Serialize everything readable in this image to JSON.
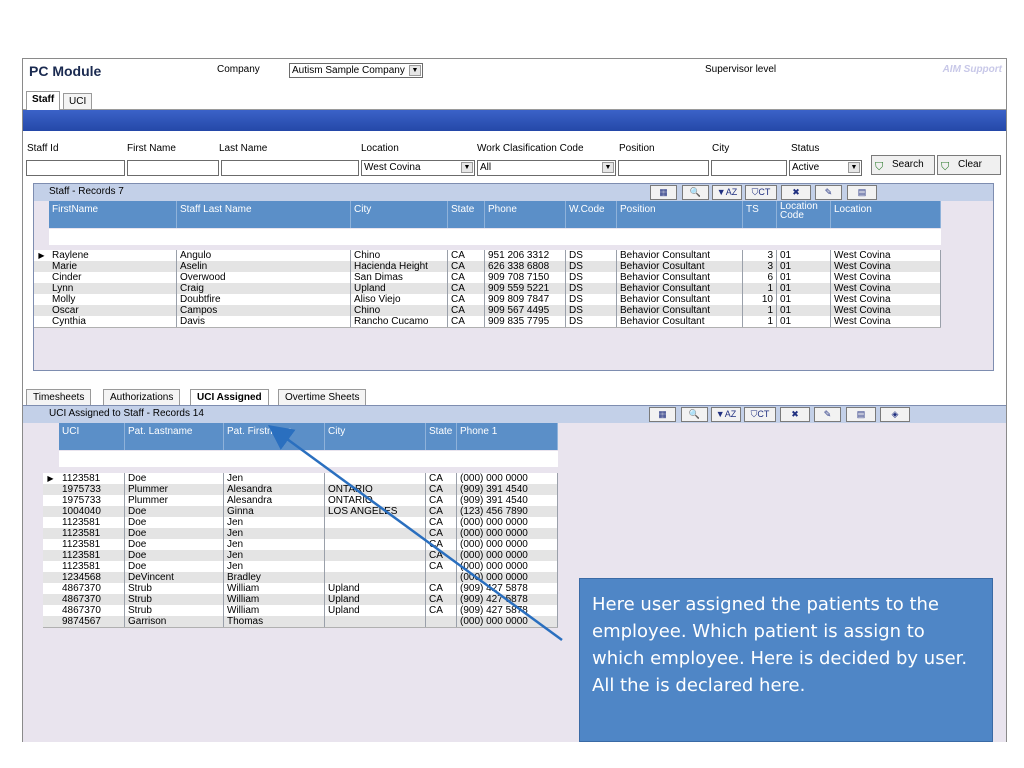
{
  "header": {
    "module_title": "PC Module",
    "company_label": "Company",
    "company_value": "Autism Sample Company",
    "supervisor_label": "Supervisor level",
    "support_label": "AIM Support"
  },
  "top_tabs": [
    "Staff",
    "UCI"
  ],
  "filters": {
    "labels": [
      "Staff Id",
      "First Name",
      "Last Name",
      "Location",
      "Work Clasification Code",
      "Position",
      "City",
      "Status"
    ],
    "location_value": "West Covina",
    "work_code_value": "All",
    "status_value": "Active",
    "search_label": "Search",
    "clear_label": "Clear"
  },
  "staff_grid": {
    "title": "Staff - Records 7",
    "toolbar": [
      "excel-icon",
      "preview-icon",
      "AZ",
      "CT",
      "clear-filter-icon",
      "edit-icon",
      "columns-icon"
    ],
    "columns": [
      "FirstName",
      "Staff Last Name",
      "City",
      "State",
      "Phone",
      "W.Code",
      "Position",
      "TS",
      "Location Code",
      "Location"
    ],
    "rows": [
      [
        "Raylene",
        "Angulo",
        "Chino",
        "CA",
        "951 206 3312",
        "DS",
        "Behavior Consultant",
        "3",
        "01",
        "West Covina"
      ],
      [
        "Marie",
        "Aselin",
        "Hacienda Height",
        "CA",
        "626 338 6808",
        "DS",
        "Behavior Cosultant",
        "3",
        "01",
        "West Covina"
      ],
      [
        "Cinder",
        "Overwood",
        "San Dimas",
        "CA",
        "909 708 7150",
        "DS",
        "Behavior Consultant",
        "6",
        "01",
        "West Covina"
      ],
      [
        "Lynn",
        "Craig",
        "Upland",
        "CA",
        "909 559 5221",
        "DS",
        "Behavior Consultant",
        "1",
        "01",
        "West Covina"
      ],
      [
        "Molly",
        "Doubtfire",
        "Aliso Viejo",
        "CA",
        "909 809 7847",
        "DS",
        "Behavior Consultant",
        "10",
        "01",
        "West Covina"
      ],
      [
        "Oscar",
        "Campos",
        "Chino",
        "CA",
        "909 567 4495",
        "DS",
        "Behavior Consultant",
        "1",
        "01",
        "West Covina"
      ],
      [
        "Cynthia",
        "Davis",
        "Rancho Cucamo",
        "CA",
        "909 835 7795",
        "DS",
        "Behavior Cosultant",
        "1",
        "01",
        "West Covina"
      ]
    ]
  },
  "lower_tabs": [
    "Timesheets",
    "Authorizations",
    "UCI Assigned",
    "Overtime Sheets"
  ],
  "uci_grid": {
    "title": "UCI Assigned to Staff  - Records 14",
    "columns": [
      "UCI",
      "Pat. Lastname",
      "Pat. Firstname",
      "City",
      "State",
      "Phone 1"
    ],
    "rows": [
      [
        "1123581",
        "Doe",
        "Jen",
        "",
        "CA",
        "(000) 000 0000"
      ],
      [
        "1975733",
        "Plummer",
        "Alesandra",
        "ONTARIO",
        "CA",
        "(909) 391 4540"
      ],
      [
        "1975733",
        "Plummer",
        "Alesandra",
        "ONTARIO",
        "CA",
        "(909) 391 4540"
      ],
      [
        "1004040",
        "Doe",
        "Ginna",
        "LOS ANGELES",
        "CA",
        "(123) 456 7890"
      ],
      [
        "1123581",
        "Doe",
        "Jen",
        "",
        "CA",
        "(000) 000 0000"
      ],
      [
        "1123581",
        "Doe",
        "Jen",
        "",
        "CA",
        "(000) 000 0000"
      ],
      [
        "1123581",
        "Doe",
        "Jen",
        "",
        "CA",
        "(000) 000 0000"
      ],
      [
        "1123581",
        "Doe",
        "Jen",
        "",
        "CA",
        "(000) 000 0000"
      ],
      [
        "1123581",
        "Doe",
        "Jen",
        "",
        "CA",
        "(000) 000 0000"
      ],
      [
        "1234568",
        "DeVincent",
        "Bradley",
        "",
        "",
        "(000) 000 0000"
      ],
      [
        "4867370",
        "Strub",
        "William",
        "Upland",
        "CA",
        "(909) 427 5878"
      ],
      [
        "4867370",
        "Strub",
        "William",
        "Upland",
        "CA",
        "(909) 427 5878"
      ],
      [
        "4867370",
        "Strub",
        "William",
        "Upland",
        "CA",
        "(909) 427 5878"
      ],
      [
        "9874567",
        "Garrison",
        "Thomas",
        "",
        "",
        "(000) 000 0000"
      ]
    ]
  },
  "callout": {
    "text": "Here user assigned the patients to the employee. Which patient is assign to which employee. Here is decided by user. All the is declared here."
  },
  "colors": {
    "header_blue": "#2448a8",
    "grid_header": "#5b8fc8",
    "callout_bg": "#4f86c6",
    "arrow": "#2a6fbf"
  }
}
